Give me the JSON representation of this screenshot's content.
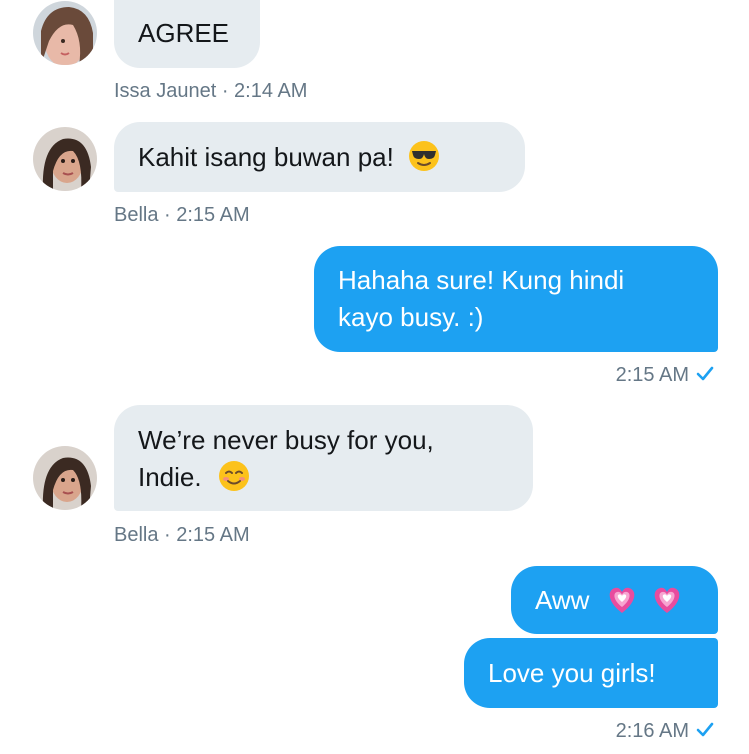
{
  "messages": [
    {
      "text": "AGREE",
      "sender": "Issa Jaunet",
      "time": "2:14 AM"
    },
    {
      "text": "Kahit isang buwan pa!",
      "emoji": "smiling-face-with-sunglasses",
      "sender": "Bella",
      "time": "2:15 AM"
    },
    {
      "lines": [
        "Hahaha sure! Kung hindi",
        "kayo busy. :)"
      ],
      "time": "2:15 AM",
      "status": "read"
    },
    {
      "lines": [
        "We’re never busy for you,",
        "Indie."
      ],
      "emoji": "smiling-face",
      "sender": "Bella",
      "time": "2:15 AM"
    },
    {
      "text": "Aww",
      "emoji": "growing-heart",
      "emoji_count": 2
    },
    {
      "text": "Love you girls!",
      "time": "2:16 AM",
      "status": "read"
    }
  ],
  "meta": {
    "m1": "Issa Jaunet · 2:14 AM",
    "m2": "Bella · 2:15 AM",
    "m3": "2:15 AM",
    "m4": "Bella · 2:15 AM",
    "m6": "2:16 AM"
  },
  "colors": {
    "outgoing_bubble": "#1da1f2",
    "incoming_bubble": "#e6ecf0",
    "meta_text": "#657786",
    "checkmark": "#1da1f2"
  }
}
